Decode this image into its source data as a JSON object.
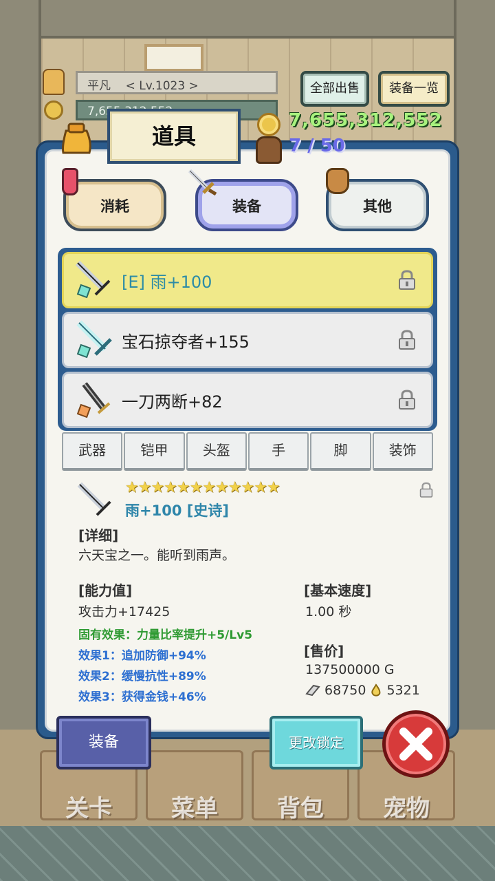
{
  "player": {
    "name": "平凡",
    "level": "< Lv.1023 >",
    "gold_partial": "7,655,312,552"
  },
  "top_buttons": {
    "sell_all": "全部出售",
    "equipment_list": "装备一览"
  },
  "panel": {
    "title": "道具",
    "gold": "7,655,312,552",
    "bag_count": "7 / 50"
  },
  "categories": [
    {
      "label": "消耗"
    },
    {
      "label": "装备"
    },
    {
      "label": "其他"
    }
  ],
  "items": [
    {
      "name": "[E] 雨+100",
      "selected": true
    },
    {
      "name": "宝石掠夺者+155",
      "selected": false
    },
    {
      "name": "一刀两断+82",
      "selected": false
    }
  ],
  "sub_tabs": [
    "武器",
    "铠甲",
    "头盔",
    "手",
    "脚",
    "装饰"
  ],
  "detail": {
    "stars": "★★★★★★★★★★★★",
    "title": "雨+100 [史诗]",
    "detail_label": "[详细]",
    "description": "六天宝之一。能听到雨声。",
    "stats_label": "[能力值]",
    "attack": "攻击力+17425",
    "inherent": "固有效果：力量比率提升+5/Lv5",
    "effect1": "效果1：追加防御+94%",
    "effect2": "效果2：缓慢抗性+89%",
    "effect3": "效果3：获得金钱+46%",
    "speed_label": "[基本速度]",
    "speed": "1.00 秒",
    "price_label": "[售价]",
    "price": "137500000 G",
    "ore": "68750",
    "drop": "5321"
  },
  "actions": {
    "equip": "装备",
    "change_lock": "更改锁定"
  },
  "nav": [
    "关卡",
    "菜单",
    "背包",
    "宠物"
  ],
  "colors": {
    "panel_border": "#2b5b8c",
    "selected_row": "#f0e98a",
    "gold_text": "#a8f27e",
    "epic_title": "#2f86aa"
  }
}
